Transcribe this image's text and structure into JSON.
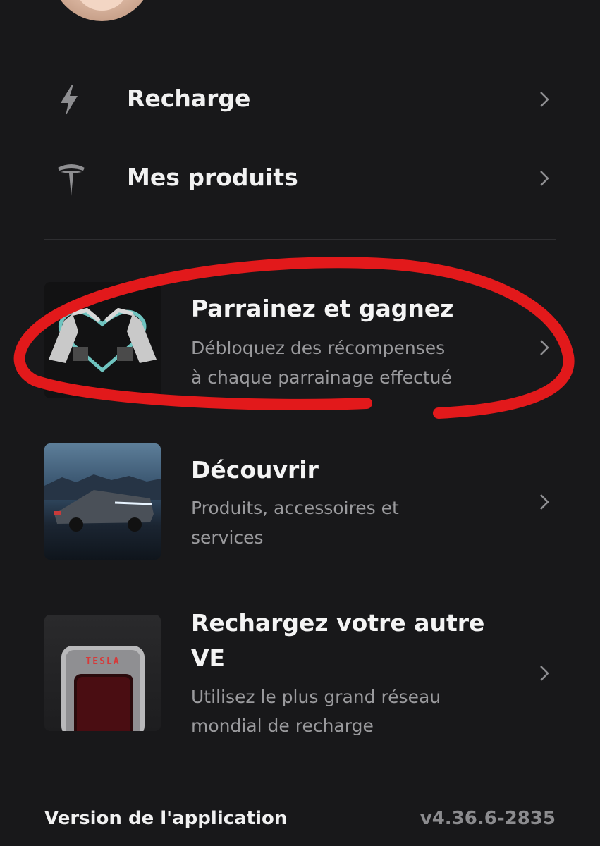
{
  "menu": {
    "items": [
      {
        "label": "Recharge",
        "icon": "bolt-icon"
      },
      {
        "label": "Mes produits",
        "icon": "tesla-logo-icon"
      }
    ]
  },
  "cards": [
    {
      "title": "Parrainez et gagnez",
      "subtitle_line1": "Débloquez des récompenses",
      "subtitle_line2": "à chaque parrainage effectué"
    },
    {
      "title": "Découvrir",
      "subtitle_line1": "Produits, accessoires et",
      "subtitle_line2": "services"
    },
    {
      "title_line1": "Rechargez votre autre",
      "title_line2": "VE",
      "subtitle_line1": "Utilisez le plus grand réseau",
      "subtitle_line2": "mondial de recharge",
      "badge": "TESLA"
    }
  ],
  "footer": {
    "label": "Version de l'application",
    "version": "v4.36.6-2835"
  },
  "colors": {
    "background": "#18181a",
    "annotation": "#e2191b"
  }
}
